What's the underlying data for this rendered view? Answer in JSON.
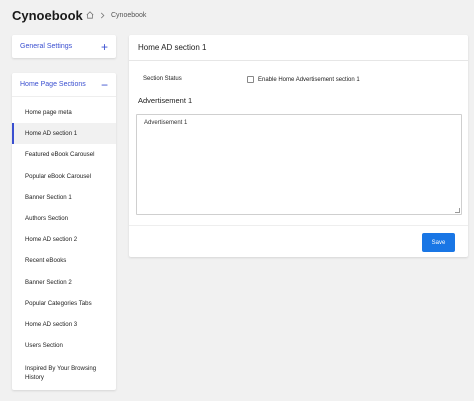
{
  "app": {
    "title": "Cynoebook"
  },
  "breadcrumb": {
    "current": "Cynoebook"
  },
  "sidebar": {
    "general": {
      "label": "General Settings",
      "toggle": "+"
    },
    "homepage": {
      "label": "Home Page Sections",
      "toggle": "−",
      "items": [
        "Home page meta",
        "Home AD section 1",
        "Featured eBook Carousel",
        "Popular eBook Carousel",
        "Banner Section 1",
        "Authors Section",
        "Home AD section 2",
        "Recent eBooks",
        "Banner Section 2",
        "Popular Categories Tabs",
        "Home AD section 3",
        "Users Section",
        "Inspired By Your Browsing History"
      ]
    }
  },
  "main": {
    "title": "Home AD section 1",
    "status_label": "Section Status",
    "checkbox_label": "Enable Home Advertisement section 1",
    "ad_label": "Advertisement 1",
    "ad_value": "Advertisement 1",
    "save_label": "Save"
  }
}
